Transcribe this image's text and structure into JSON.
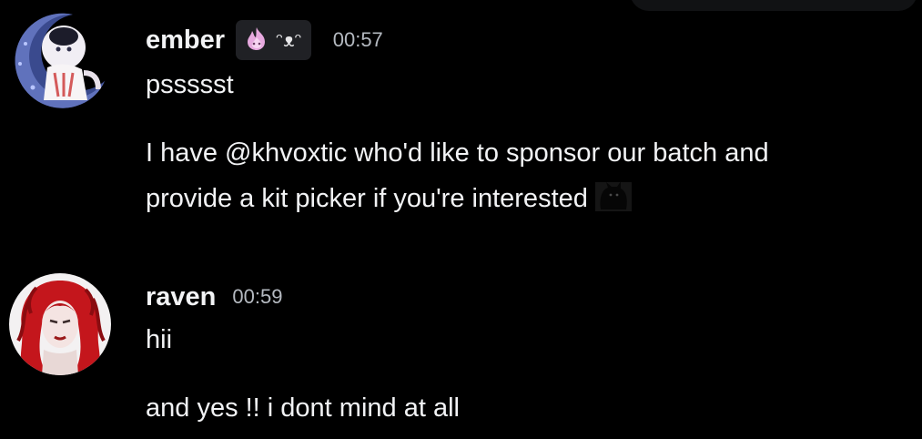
{
  "messages": [
    {
      "username": "ember",
      "tag_text": "ᵔᴥᵔ",
      "tag_icon": "pink-flame-icon",
      "timestamp": "00:57",
      "lines": [
        "pssssst",
        "I have @khvoxtic who'd like to sponsor our batch and",
        "provide a kit picker if you're interested"
      ],
      "inline_emoji": "black-cat-emoji"
    },
    {
      "username": "raven",
      "timestamp": "00:59",
      "lines": [
        "hii",
        "and yes !! i dont mind at all"
      ]
    }
  ],
  "colors": {
    "background": "#000000",
    "text": "#f2f3f5",
    "timestamp": "#b5bac1",
    "tag_background": "#202125",
    "tag_flame": "#e7a9df"
  }
}
